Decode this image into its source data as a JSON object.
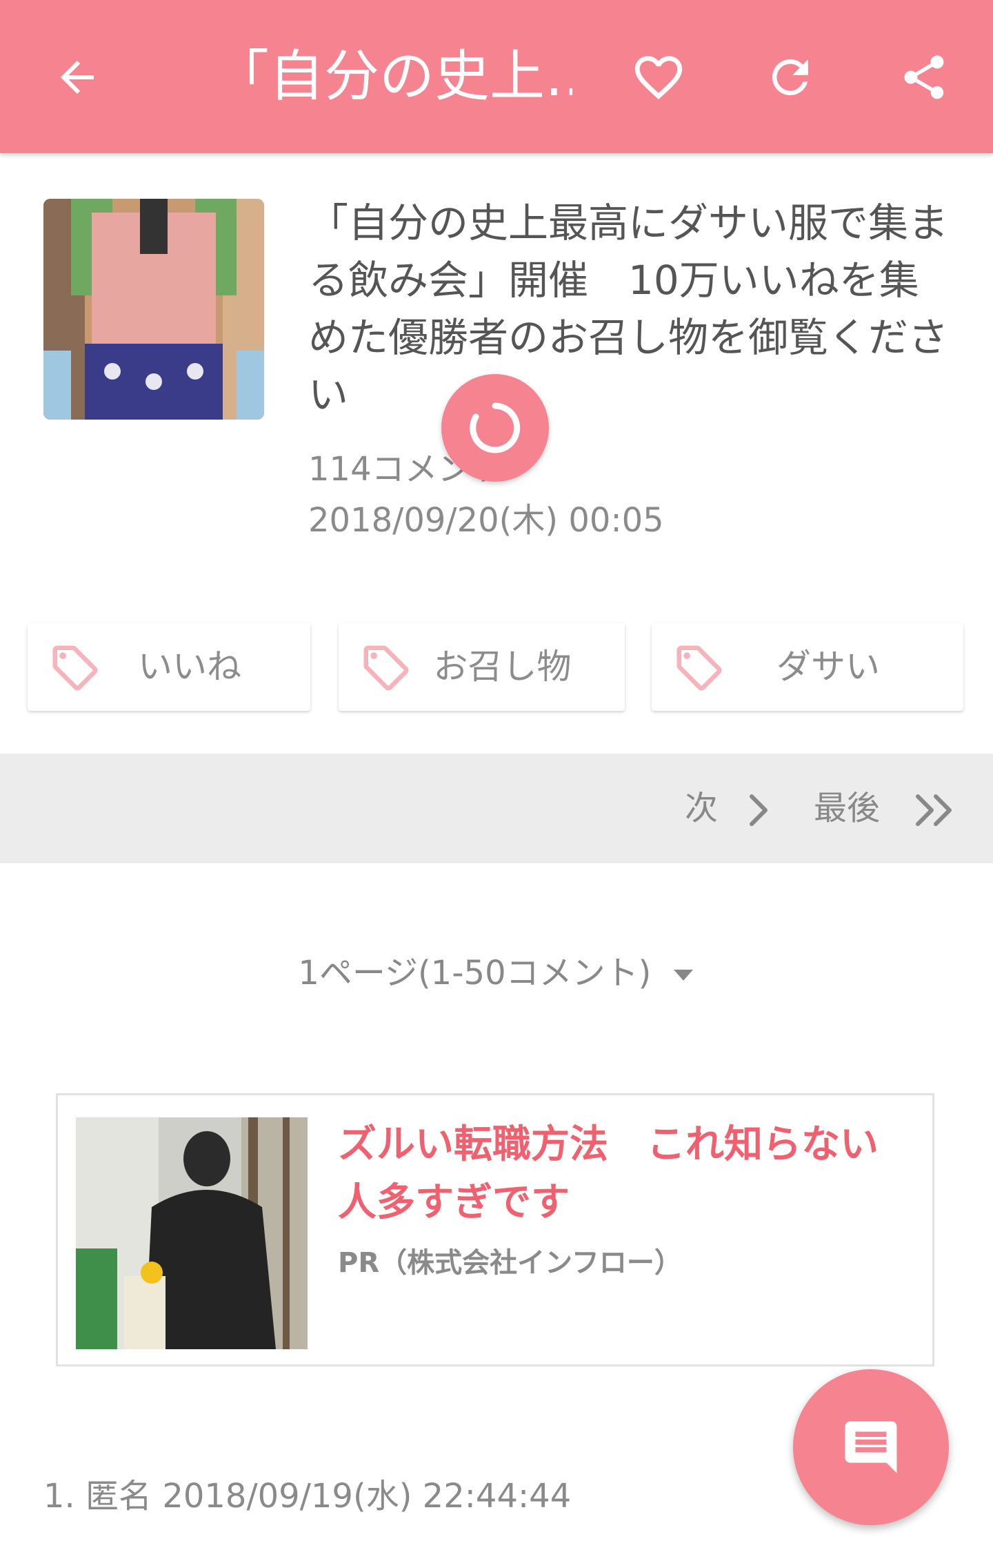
{
  "appbar": {
    "title": "「自分の史上…",
    "back_icon": "arrow-left-icon",
    "favorite_icon": "heart-outline-icon",
    "refresh_icon": "refresh-icon",
    "share_icon": "share-icon",
    "color": "#f58490"
  },
  "article": {
    "headline": "「自分の史上最高にダサい服で集まる飲み会」開催　10万いいねを集めた優勝者のお召し物を御覧ください",
    "comment_count": "114コメント",
    "datetime": "2018/09/20(木) 00:05"
  },
  "tags": [
    {
      "label": "いいね",
      "icon": "tag-icon"
    },
    {
      "label": "お召し物",
      "icon": "tag-icon"
    },
    {
      "label": "ダサい",
      "icon": "tag-icon"
    }
  ],
  "pager": {
    "next_label": "次",
    "last_label": "最後"
  },
  "page_select": {
    "label": "1ページ(1-50コメント)"
  },
  "ad": {
    "title": "ズルい転職方法　これ知らない人多すぎです",
    "sponsor": "PR（株式会社インフロー）",
    "title_color": "#f0606e"
  },
  "fab": {
    "icon": "message-icon"
  },
  "comments": [
    {
      "header": "1. 匿名 2018/09/19(水) 22:44:44"
    }
  ]
}
